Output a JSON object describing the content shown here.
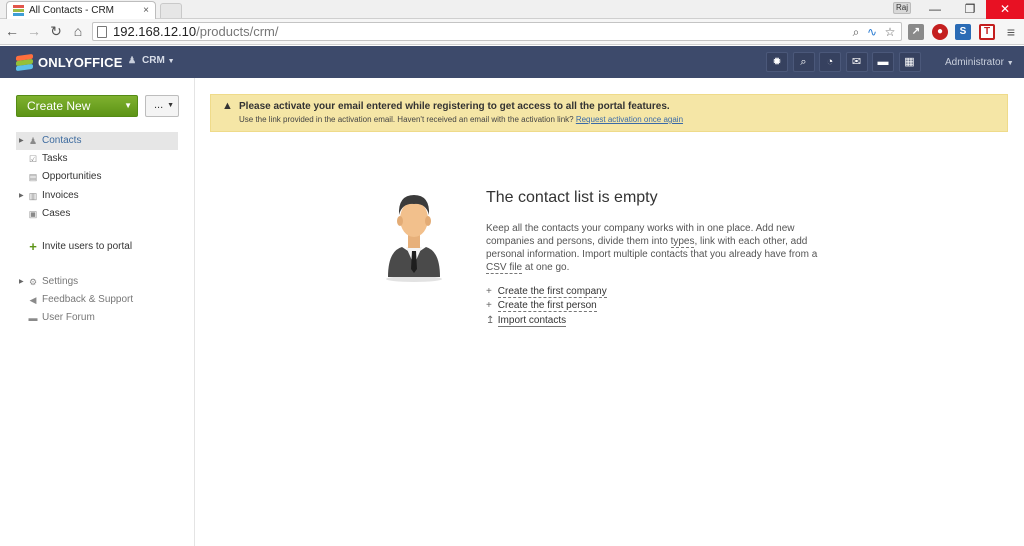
{
  "browser": {
    "tab_title": "All Contacts - CRM",
    "tab_close": "×",
    "user_chip": "Raj",
    "url_host": "192.168.12.10",
    "url_path": "/products/crm/",
    "win_min": "—",
    "win_max": "❐",
    "win_close": "✕"
  },
  "header": {
    "logo_text": "ONLYOFFICE",
    "module_label": "CRM",
    "admin_label": "Administrator"
  },
  "sidebar": {
    "create_new_label": "Create New",
    "more_label": "...",
    "items": [
      {
        "label": "Contacts"
      },
      {
        "label": "Tasks"
      },
      {
        "label": "Opportunities"
      },
      {
        "label": "Invoices"
      },
      {
        "label": "Cases"
      },
      {
        "label": "Invite users to portal"
      },
      {
        "label": "Settings"
      },
      {
        "label": "Feedback & Support"
      },
      {
        "label": "User Forum"
      }
    ]
  },
  "banner": {
    "title": "Please activate your email entered while registering to get access to all the portal features.",
    "text": "Use the link provided in the activation email. Haven't received an email with the activation link?",
    "link": "Request activation once again"
  },
  "empty": {
    "title": "The contact list is empty",
    "desc_1": "Keep all the contacts your company works with in one place. Add new companies and persons, divide them into ",
    "desc_types": "types",
    "desc_2": ", link with each other, add personal information. Import multiple contacts that you already have from a ",
    "desc_csv": "CSV file",
    "desc_3": " at one go.",
    "actions": [
      {
        "label": "Create the first company",
        "icon": "+"
      },
      {
        "label": "Create the first person",
        "icon": "+"
      },
      {
        "label": "Import contacts",
        "icon": "↥"
      }
    ]
  },
  "colors": {
    "header_bg": "#3d4a6b",
    "create_btn": "#6ea523",
    "banner_bg": "#f5e6a6",
    "active_item_text": "#3d6b9f"
  },
  "icons": {
    "tab_favicon": "onlyoffice-logo-icon",
    "header": [
      "settings-icon",
      "search-icon",
      "feed-icon",
      "mail-icon",
      "chat-icon",
      "calendar-icon"
    ]
  }
}
